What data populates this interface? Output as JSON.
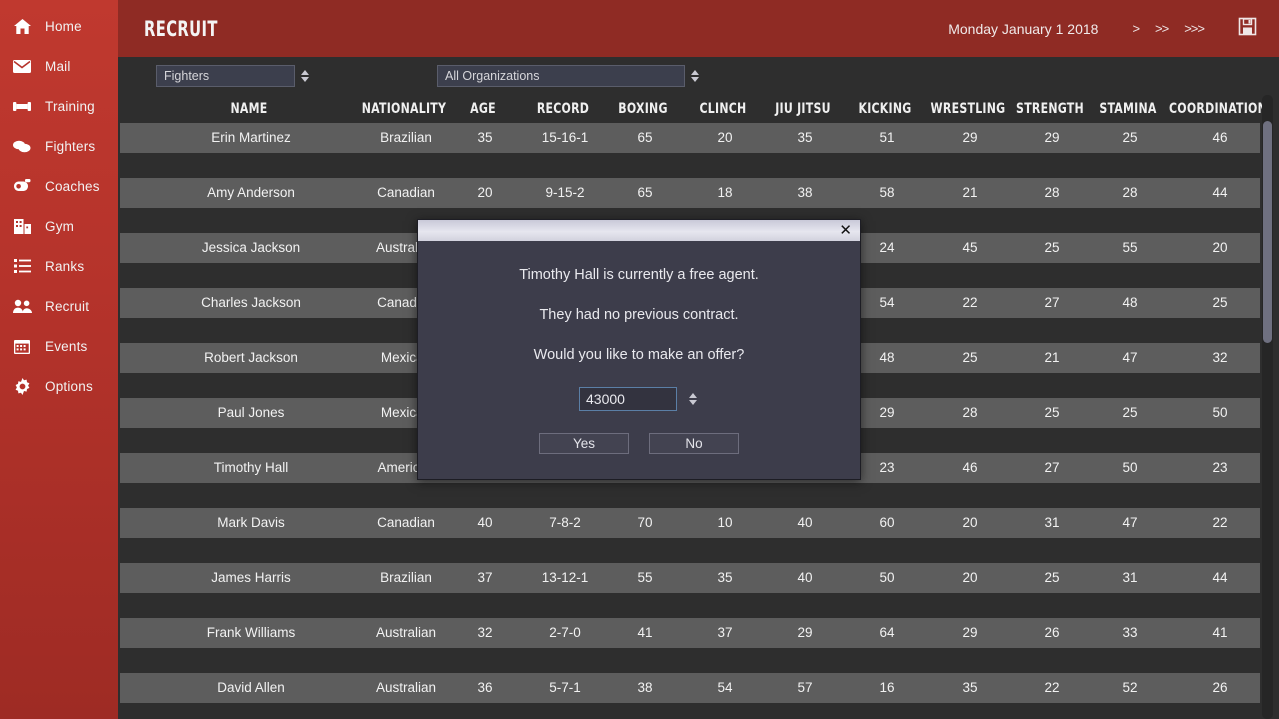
{
  "sidebar": {
    "items": [
      {
        "label": "Home",
        "icon": "home-icon"
      },
      {
        "label": "Mail",
        "icon": "mail-icon"
      },
      {
        "label": "Training",
        "icon": "dumbbell-icon"
      },
      {
        "label": "Fighters",
        "icon": "gloves-icon"
      },
      {
        "label": "Coaches",
        "icon": "whistle-icon"
      },
      {
        "label": "Gym",
        "icon": "building-icon"
      },
      {
        "label": "Ranks",
        "icon": "list-icon"
      },
      {
        "label": "Recruit",
        "icon": "people-icon"
      },
      {
        "label": "Events",
        "icon": "calendar-icon"
      },
      {
        "label": "Options",
        "icon": "gear-icon"
      }
    ]
  },
  "header": {
    "title": "RECRUIT",
    "date": "Monday January 1 2018",
    "advance_1": ">",
    "advance_2": ">>",
    "advance_3": ">>>",
    "save_icon": "floppy-save-icon"
  },
  "filters": {
    "type_select": {
      "value": "Fighters"
    },
    "org_select": {
      "value": "All Organizations"
    }
  },
  "table": {
    "columns": [
      "NAME",
      "NATIONALITY",
      "AGE",
      "RECORD",
      "BOXING",
      "CLINCH",
      "JIU JITSU",
      "KICKING",
      "WRESTLING",
      "STRENGTH",
      "STAMINA",
      "COORDINATION"
    ],
    "rows": [
      {
        "name": "Erin Martinez",
        "nationality": "Brazilian",
        "age": "35",
        "record": "15-16-1",
        "boxing": "65",
        "clinch": "20",
        "jiu_jitsu": "35",
        "kicking": "51",
        "wrestling": "29",
        "strength": "29",
        "stamina": "25",
        "coordination": "46"
      },
      {
        "name": "Amy Anderson",
        "nationality": "Canadian",
        "age": "20",
        "record": "9-15-2",
        "boxing": "65",
        "clinch": "18",
        "jiu_jitsu": "38",
        "kicking": "58",
        "wrestling": "21",
        "strength": "28",
        "stamina": "28",
        "coordination": "44"
      },
      {
        "name": "Jessica Jackson",
        "nationality": "Australian",
        "age": "",
        "record": "",
        "boxing": "",
        "clinch": "",
        "jiu_jitsu": "",
        "kicking": "24",
        "wrestling": "45",
        "strength": "25",
        "stamina": "55",
        "coordination": "20"
      },
      {
        "name": "Charles Jackson",
        "nationality": "Canadian",
        "age": "",
        "record": "",
        "boxing": "",
        "clinch": "",
        "jiu_jitsu": "",
        "kicking": "54",
        "wrestling": "22",
        "strength": "27",
        "stamina": "48",
        "coordination": "25"
      },
      {
        "name": "Robert Jackson",
        "nationality": "Mexican",
        "age": "",
        "record": "",
        "boxing": "",
        "clinch": "",
        "jiu_jitsu": "",
        "kicking": "48",
        "wrestling": "25",
        "strength": "21",
        "stamina": "47",
        "coordination": "32"
      },
      {
        "name": "Paul Jones",
        "nationality": "Mexican",
        "age": "",
        "record": "",
        "boxing": "",
        "clinch": "",
        "jiu_jitsu": "",
        "kicking": "29",
        "wrestling": "28",
        "strength": "25",
        "stamina": "25",
        "coordination": "50"
      },
      {
        "name": "Timothy Hall",
        "nationality": "American",
        "age": "",
        "record": "",
        "boxing": "",
        "clinch": "",
        "jiu_jitsu": "",
        "kicking": "23",
        "wrestling": "46",
        "strength": "27",
        "stamina": "50",
        "coordination": "23"
      },
      {
        "name": "Mark Davis",
        "nationality": "Canadian",
        "age": "40",
        "record": "7-8-2",
        "boxing": "70",
        "clinch": "10",
        "jiu_jitsu": "40",
        "kicking": "60",
        "wrestling": "20",
        "strength": "31",
        "stamina": "47",
        "coordination": "22"
      },
      {
        "name": "James Harris",
        "nationality": "Brazilian",
        "age": "37",
        "record": "13-12-1",
        "boxing": "55",
        "clinch": "35",
        "jiu_jitsu": "40",
        "kicking": "50",
        "wrestling": "20",
        "strength": "25",
        "stamina": "31",
        "coordination": "44"
      },
      {
        "name": "Frank Williams",
        "nationality": "Australian",
        "age": "32",
        "record": "2-7-0",
        "boxing": "41",
        "clinch": "37",
        "jiu_jitsu": "29",
        "kicking": "64",
        "wrestling": "29",
        "strength": "26",
        "stamina": "33",
        "coordination": "41"
      },
      {
        "name": "David Allen",
        "nationality": "Australian",
        "age": "36",
        "record": "5-7-1",
        "boxing": "38",
        "clinch": "54",
        "jiu_jitsu": "57",
        "kicking": "16",
        "wrestling": "35",
        "strength": "22",
        "stamina": "52",
        "coordination": "26"
      }
    ]
  },
  "modal": {
    "close_label": "✕",
    "line1": "Timothy Hall is currently a free agent.",
    "line2": "They had no previous contract.",
    "line3": "Would you like to make an offer?",
    "offer_value": "43000",
    "yes_label": "Yes",
    "no_label": "No"
  },
  "colors": {
    "sidebar_red": "#b5332b",
    "header_red": "#8f2b24",
    "content_bg": "#2e2e2e",
    "row_bg": "#5d5d5d",
    "modal_bg": "#3d3d4b",
    "focus_blue": "#5b7fa6"
  }
}
